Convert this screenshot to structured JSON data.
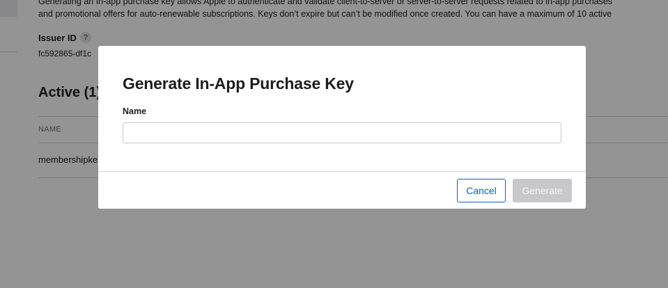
{
  "background": {
    "description_lines": [
      "Generating an In-app purchase key allows Apple to authenticate and validate client-to-server or server-to-server requests related to in-app purchases",
      "and promotional offers for auto-renewable subscriptions. Keys don’t expire but can’t be modified once created. You can have a maximum of 10 active"
    ],
    "issuer_label": "Issuer ID",
    "help_glyph": "?",
    "issuer_value": "fc592865-df1c",
    "active_title": "Active (1)",
    "table": {
      "columns": [
        "NAME"
      ],
      "rows": [
        {
          "name": "membershipke"
        }
      ]
    }
  },
  "modal": {
    "title": "Generate In-App Purchase Key",
    "name_label": "Name",
    "name_value": "",
    "name_placeholder": "",
    "cancel_label": "Cancel",
    "generate_label": "Generate"
  },
  "colors": {
    "accent": "#0a63b8",
    "overlay": "rgba(0,0,0,0.42)",
    "disabled_button": "#c7c7cc"
  }
}
